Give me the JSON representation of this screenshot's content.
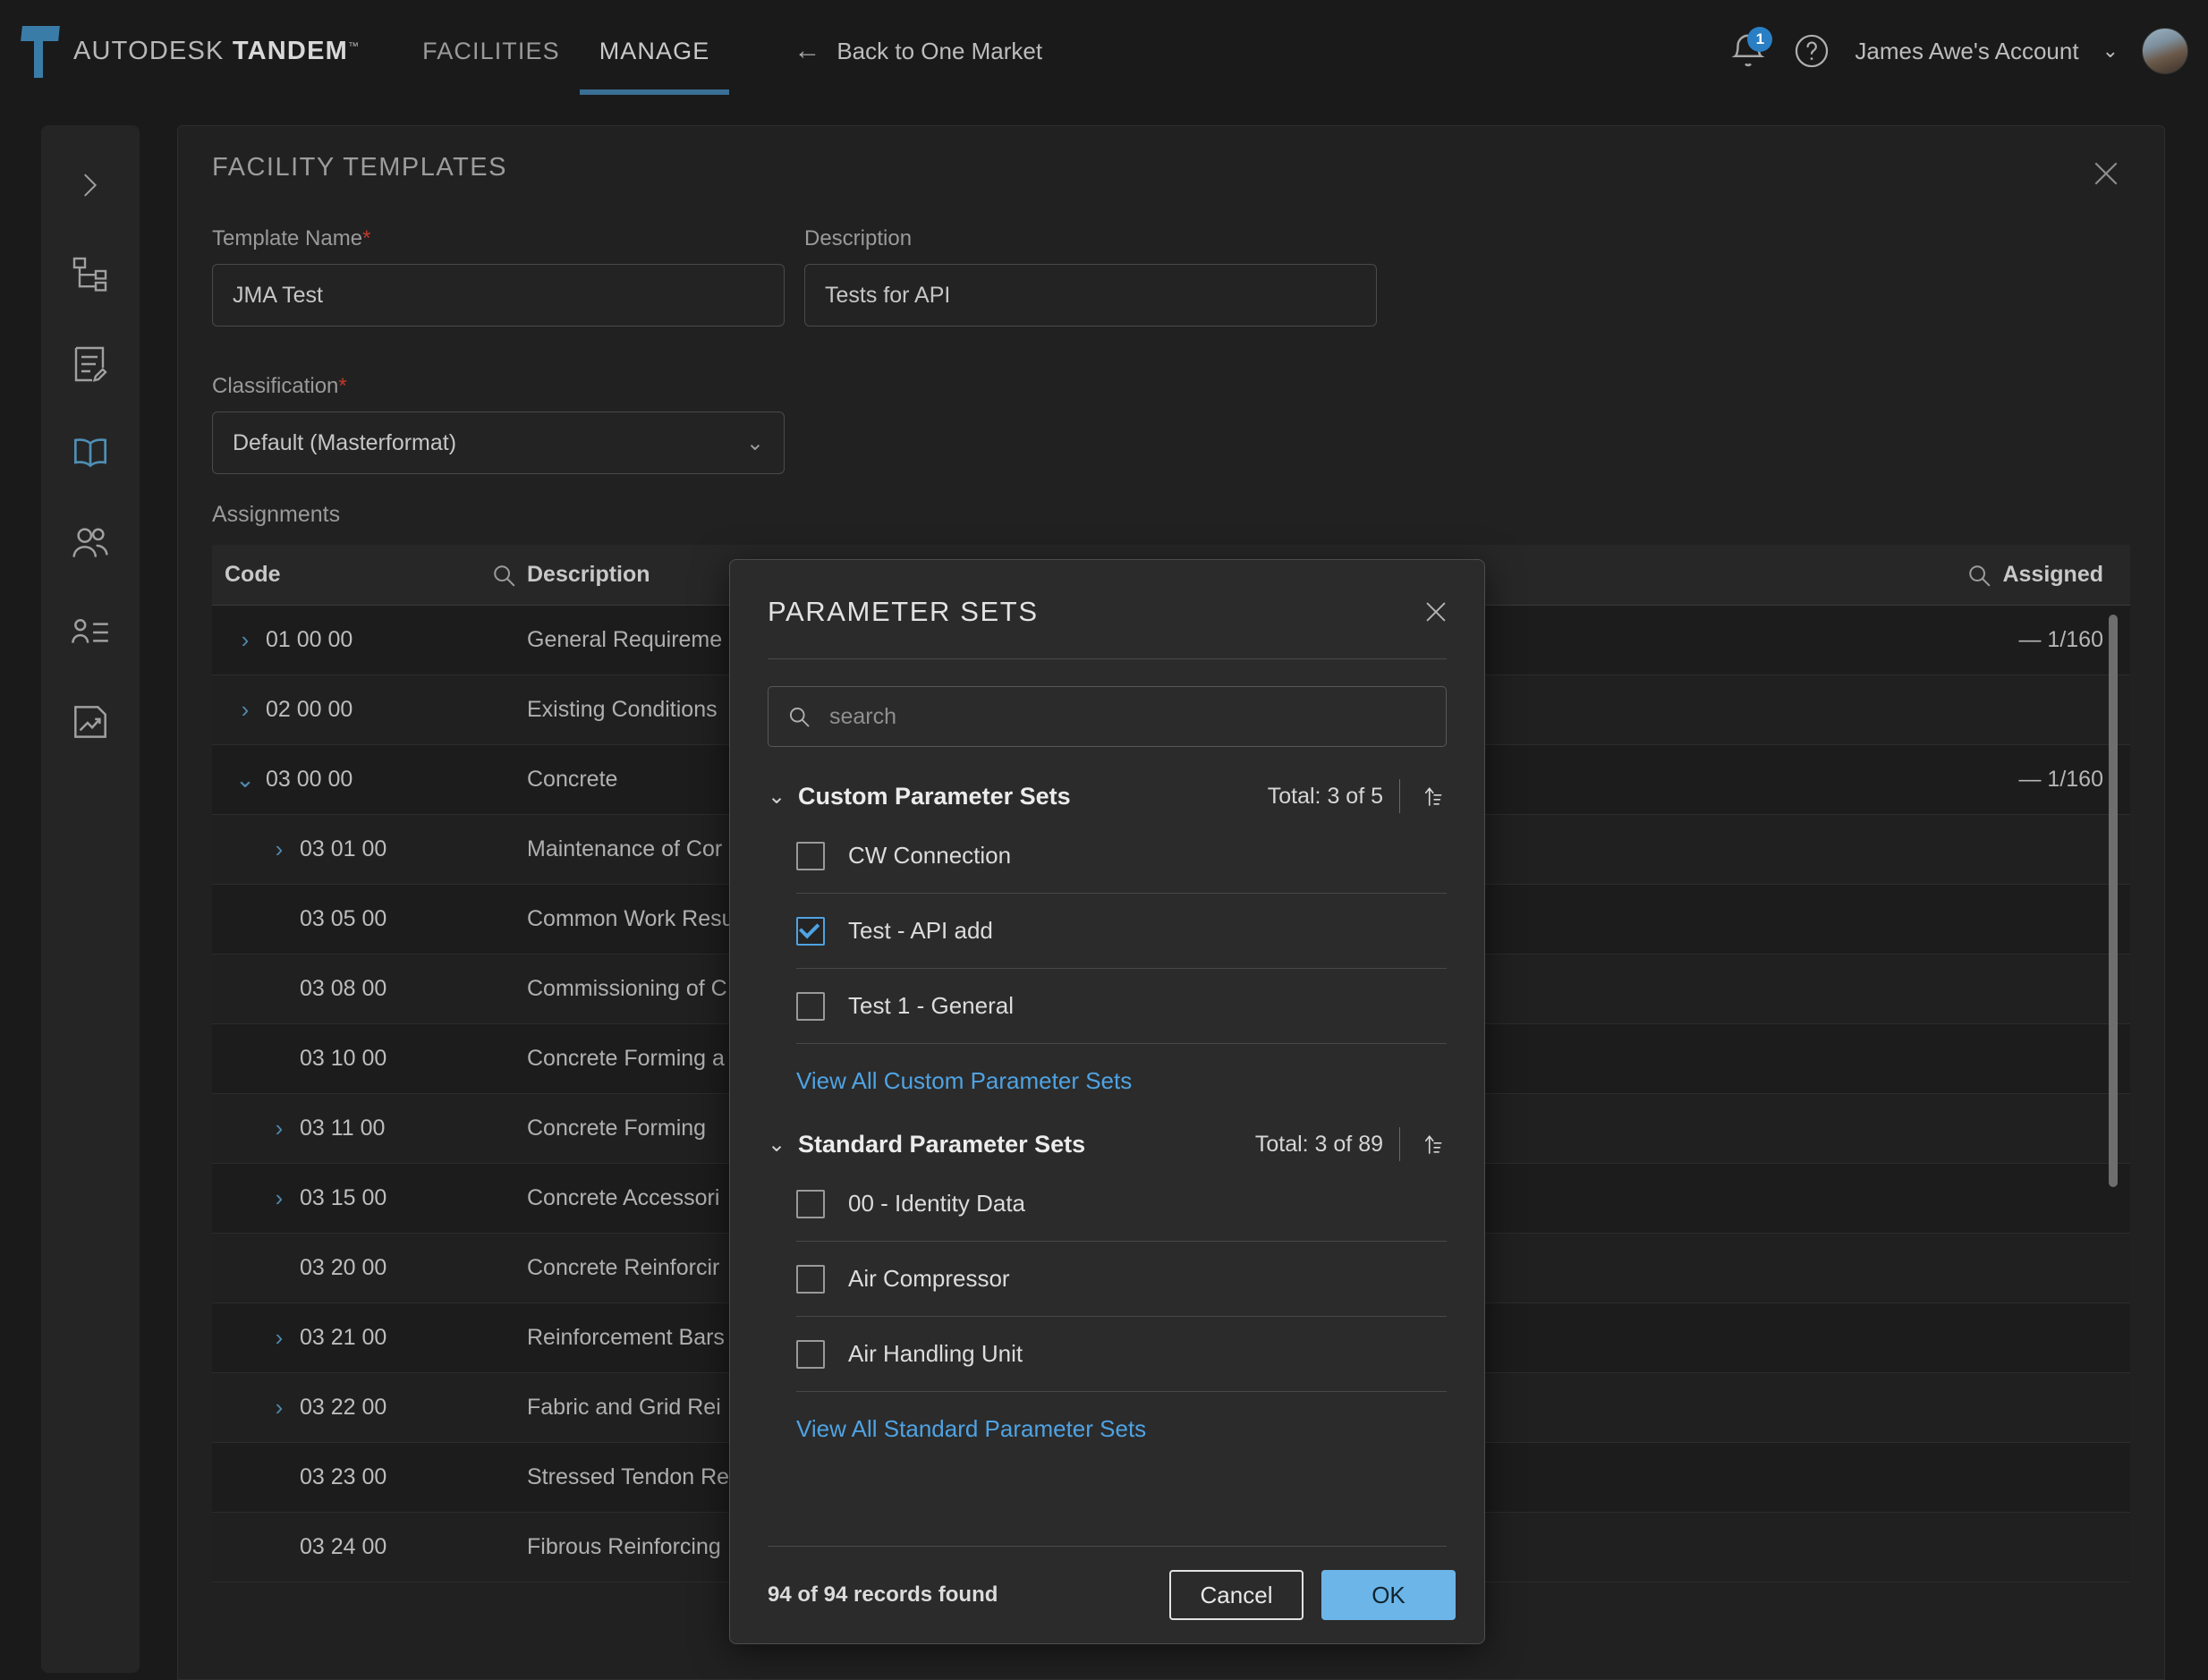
{
  "header": {
    "brand_prefix": "AUTODESK ",
    "brand_bold": "TANDEM",
    "brand_tm": "™",
    "tabs": [
      {
        "label": "FACILITIES",
        "active": false
      },
      {
        "label": "MANAGE",
        "active": true
      }
    ],
    "back_link": "Back to One Market",
    "back_arrow_icon": "arrow-left-icon",
    "notification_count": "1",
    "help_icon": "question-circle-icon",
    "account_label": "James Awe's Account",
    "account_chevron_icon": "chevron-down-icon",
    "avatar_icon": "user-avatar"
  },
  "sidebar": {
    "items": [
      {
        "icon": "chevron-right-expand-icon",
        "name": "expand-rail",
        "active": false
      },
      {
        "icon": "hierarchy-icon",
        "name": "sidebar-item-hierarchy",
        "active": false
      },
      {
        "icon": "document-edit-icon",
        "name": "sidebar-item-document",
        "active": false
      },
      {
        "icon": "open-book-icon",
        "name": "sidebar-item-templates",
        "active": true
      },
      {
        "icon": "users-icon",
        "name": "sidebar-item-users",
        "active": false
      },
      {
        "icon": "contact-list-icon",
        "name": "sidebar-item-contacts",
        "active": false
      },
      {
        "icon": "image-chart-icon",
        "name": "sidebar-item-reports",
        "active": false
      }
    ]
  },
  "panel": {
    "title": "FACILITY TEMPLATES",
    "close_icon": "close-icon",
    "template_name": {
      "label": "Template Name",
      "required_mark": "*",
      "value": "JMA Test"
    },
    "description": {
      "label": "Description",
      "value": "Tests for API"
    },
    "classification": {
      "label": "Classification",
      "required_mark": "*",
      "value": "Default (Masterformat)",
      "chevron_icon": "chevron-down-icon"
    },
    "assignments_label": "Assignments"
  },
  "table": {
    "columns": {
      "code": "Code",
      "description": "Description",
      "assigned": "Assigned"
    },
    "search_icon": "search-icon",
    "rows": [
      {
        "code": "01 00 00",
        "description": "General Requireme",
        "assigned": "—  1/160",
        "expandable": true,
        "expanded": false,
        "indent": 0,
        "edit_icon": "pencil-icon"
      },
      {
        "code": "02 00 00",
        "description": "Existing Conditions",
        "assigned": "",
        "expandable": true,
        "expanded": false,
        "indent": 0,
        "edit_icon": ""
      },
      {
        "code": "03 00 00",
        "description": "Concrete",
        "assigned": "—  1/160",
        "expandable": true,
        "expanded": true,
        "indent": 0,
        "edit_icon": ""
      },
      {
        "code": "03 01 00",
        "description": "Maintenance of Cor",
        "assigned": "",
        "expandable": true,
        "expanded": false,
        "indent": 1,
        "edit_icon": ""
      },
      {
        "code": "03 05 00",
        "description": "Common Work Resu",
        "assigned": "",
        "expandable": false,
        "expanded": false,
        "indent": 1,
        "edit_icon": ""
      },
      {
        "code": "03 08 00",
        "description": "Commissioning of C",
        "assigned": "",
        "expandable": false,
        "expanded": false,
        "indent": 1,
        "edit_icon": ""
      },
      {
        "code": "03 10 00",
        "description": "Concrete Forming a",
        "assigned": "",
        "expandable": false,
        "expanded": false,
        "indent": 1,
        "edit_icon": ""
      },
      {
        "code": "03 11 00",
        "description": "Concrete Forming",
        "assigned": "",
        "expandable": true,
        "expanded": false,
        "indent": 1,
        "edit_icon": ""
      },
      {
        "code": "03 15 00",
        "description": "Concrete Accessori",
        "assigned": "",
        "expandable": true,
        "expanded": false,
        "indent": 1,
        "edit_icon": ""
      },
      {
        "code": "03 20 00",
        "description": "Concrete Reinforcir",
        "assigned": "",
        "expandable": false,
        "expanded": false,
        "indent": 1,
        "edit_icon": ""
      },
      {
        "code": "03 21 00",
        "description": "Reinforcement Bars",
        "assigned": "",
        "expandable": true,
        "expanded": false,
        "indent": 1,
        "edit_icon": ""
      },
      {
        "code": "03 22 00",
        "description": "Fabric and Grid Rei",
        "assigned": "",
        "expandable": true,
        "expanded": false,
        "indent": 1,
        "edit_icon": ""
      },
      {
        "code": "03 23 00",
        "description": "Stressed Tendon Re",
        "assigned": "",
        "expandable": false,
        "expanded": false,
        "indent": 1,
        "edit_icon": ""
      },
      {
        "code": "03 24 00",
        "description": "Fibrous Reinforcing",
        "assigned": "",
        "expandable": false,
        "expanded": false,
        "indent": 1,
        "edit_icon": ""
      }
    ]
  },
  "modal": {
    "title": "PARAMETER SETS",
    "close_icon": "close-icon",
    "search": {
      "placeholder": "search",
      "value": "",
      "icon": "search-icon"
    },
    "sections": [
      {
        "name": "custom",
        "title": "Custom Parameter Sets",
        "total": "Total: 3 of 5",
        "collapse_icon": "chevron-down-icon",
        "sort_icon": "sort-ascending-icon",
        "options": [
          {
            "label": "CW Connection",
            "checked": false
          },
          {
            "label": "Test - API add",
            "checked": true
          },
          {
            "label": "Test 1 - General",
            "checked": false
          }
        ],
        "view_all": "View All Custom Parameter Sets"
      },
      {
        "name": "standard",
        "title": "Standard Parameter Sets",
        "total": "Total: 3 of 89",
        "collapse_icon": "chevron-down-icon",
        "sort_icon": "sort-ascending-icon",
        "options": [
          {
            "label": "00 - Identity Data",
            "checked": false
          },
          {
            "label": "Air Compressor",
            "checked": false
          },
          {
            "label": "Air Handling Unit",
            "checked": false
          }
        ],
        "view_all": "View All Standard Parameter Sets"
      }
    ],
    "footer": {
      "records": "94 of 94 records found",
      "cancel_label": "Cancel",
      "ok_label": "OK"
    }
  },
  "colors": {
    "accent_blue": "#4fa3e3",
    "ok_button": "#6cb5e8",
    "tab_underline": "#3a6f96",
    "required_red": "#c0392b",
    "logo_blue": "#3a7ca8"
  }
}
